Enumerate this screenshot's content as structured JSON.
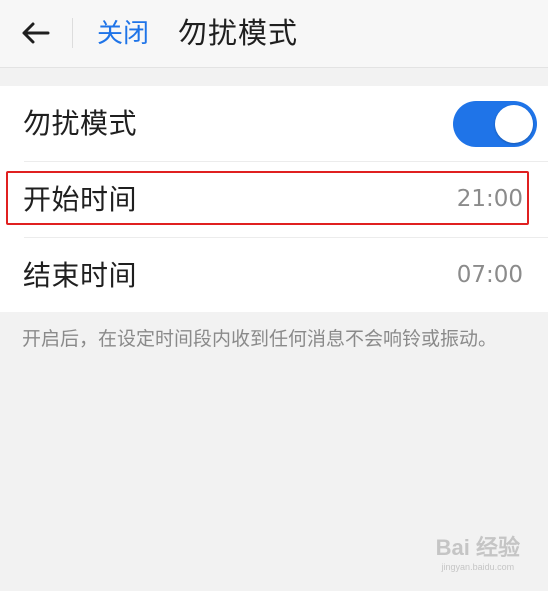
{
  "header": {
    "close_label": "关闭",
    "title": "勿扰模式"
  },
  "settings": {
    "dnd": {
      "label": "勿扰模式",
      "enabled": true
    },
    "start": {
      "label": "开始时间",
      "value": "21:00"
    },
    "end": {
      "label": "结束时间",
      "value": "07:00"
    }
  },
  "note": "开启后，在设定时间段内收到任何消息不会响铃或振动。",
  "watermark": {
    "main": "Bai 经验",
    "sub": "jingyan.baidu.com"
  },
  "colors": {
    "accent": "#1f74e8",
    "highlight": "#e02020"
  },
  "icons": {
    "back": "arrow-left-icon"
  }
}
